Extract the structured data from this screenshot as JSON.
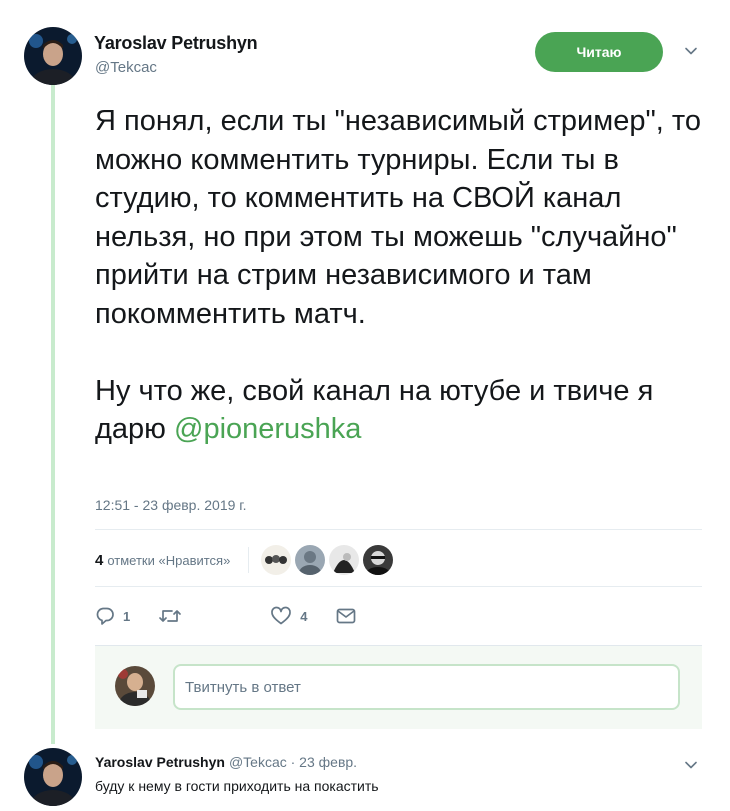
{
  "tweet": {
    "author_name": "Yaroslav Petrushyn",
    "author_handle": "@Tekcac",
    "follow_label": "Читаю",
    "text_main": "Я понял, если ты \"независимый стример\", то можно комментить турниры. Если ты в студию, то комментить на СВОЙ канал нельзя, но при этом ты можешь \"случайно\" прийти на стрим независимого и там покомментить матч.",
    "text_second": "Ну что же, свой канал на ютубе и твиче я дарю ",
    "mention": "@pionerushka",
    "timestamp": "12:51 - 23 февр. 2019 г.",
    "likes_count": "4",
    "likes_label": "отметки «Нравится»",
    "reply_count": "1",
    "retweet_count": "",
    "like_count": "4"
  },
  "composer": {
    "placeholder": "Твитнуть в ответ"
  },
  "reply": {
    "author_name": "Yaroslav Petrushyn",
    "meta": "@Tekcac · 23 февр.",
    "text": "буду к нему в гости приходить на покастить"
  },
  "colors": {
    "accent": "#4aa454",
    "thread_line": "#c8ebcd",
    "muted_text": "#657786"
  }
}
